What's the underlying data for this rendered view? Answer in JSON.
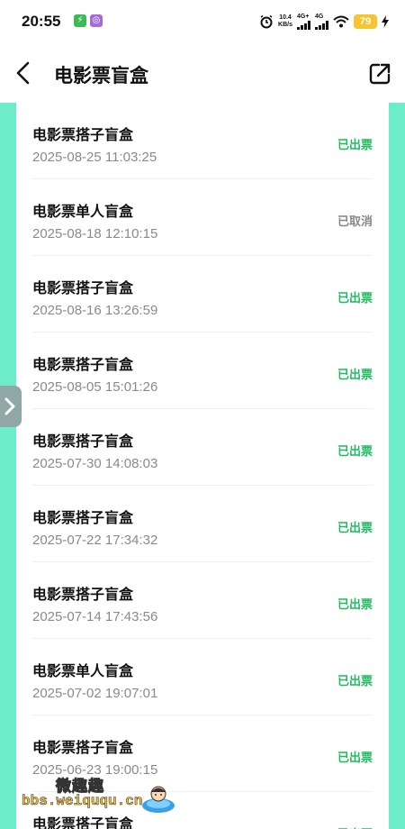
{
  "status_bar": {
    "time": "20:55",
    "speed_value": "10.4",
    "speed_unit": "KB/s",
    "signal_1": "4G+",
    "signal_2": "4G",
    "battery": "79"
  },
  "header": {
    "title": "电影票盲盒"
  },
  "orders": [
    {
      "title": "电影票搭子盲盒",
      "time": "2025-08-25 11:03:25",
      "status": "已出票",
      "status_color": "#1fbb5e"
    },
    {
      "title": "电影票单人盲盒",
      "time": "2025-08-18 12:10:15",
      "status": "已取消",
      "status_color": "#888888"
    },
    {
      "title": "电影票搭子盲盒",
      "time": "2025-08-16 13:26:59",
      "status": "已出票",
      "status_color": "#1fbb5e"
    },
    {
      "title": "电影票搭子盲盒",
      "time": "2025-08-05 15:01:26",
      "status": "已出票",
      "status_color": "#1fbb5e"
    },
    {
      "title": "电影票搭子盲盒",
      "time": "2025-07-30 14:08:03",
      "status": "已出票",
      "status_color": "#1fbb5e"
    },
    {
      "title": "电影票搭子盲盒",
      "time": "2025-07-22 17:34:32",
      "status": "已出票",
      "status_color": "#1fbb5e"
    },
    {
      "title": "电影票搭子盲盒",
      "time": "2025-07-14 17:43:56",
      "status": "已出票",
      "status_color": "#1fbb5e"
    },
    {
      "title": "电影票单人盲盒",
      "time": "2025-07-02 19:07:01",
      "status": "已出票",
      "status_color": "#1fbb5e"
    },
    {
      "title": "电影票搭子盲盒",
      "time": "2025-06-23 19:00:15",
      "status": "已出票",
      "status_color": "#1fbb5e"
    },
    {
      "title": "电影票搭子盲盒",
      "time": "",
      "status": "已出票",
      "status_color": "#1fbb5e"
    }
  ],
  "watermark": {
    "site_name": "微趣趣",
    "url": "bbs.weiququ.cn"
  },
  "colors": {
    "accent_mint": "#6cecc8",
    "issued_green": "#1fbb5e",
    "cancelled_gray": "#888888"
  },
  "icons": {
    "back": "chevron-left-icon",
    "share": "share-icon",
    "side_handle": "chevron-right-icon"
  }
}
